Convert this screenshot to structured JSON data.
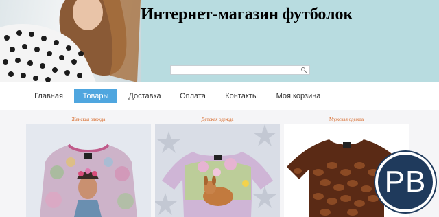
{
  "header": {
    "title": "Интернет-магазин футболок",
    "search": {
      "placeholder": "",
      "value": ""
    }
  },
  "nav": {
    "items": [
      {
        "label": "Главная"
      },
      {
        "label": "Товары"
      },
      {
        "label": "Доставка"
      },
      {
        "label": "Оплата"
      },
      {
        "label": "Контакты"
      },
      {
        "label": "Моя корзина"
      }
    ],
    "active": "Товары",
    "active_color": "#4fa6df"
  },
  "categories": [
    {
      "label": "Женская одежда"
    },
    {
      "label": "Детская одежда"
    },
    {
      "label": "Мужская одежда"
    }
  ],
  "watermark": {
    "text": "PB"
  },
  "colors": {
    "header_bg": "#b8dce0",
    "category_label": "#d86a2a",
    "badge": "#1f3a5c"
  }
}
